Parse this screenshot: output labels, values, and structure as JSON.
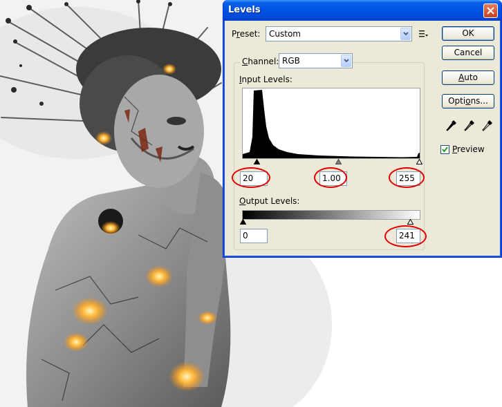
{
  "dialog": {
    "title": "Levels",
    "preset": {
      "label": "Preset:",
      "value": "Custom"
    },
    "channel": {
      "label": "Channel:",
      "value": "RGB"
    },
    "input_levels": {
      "label": "Input Levels:",
      "black": "20",
      "gamma": "1.00",
      "white": "255"
    },
    "output_levels": {
      "label": "Output Levels:",
      "black": "0",
      "white": "241"
    },
    "buttons": {
      "ok": "OK",
      "cancel": "Cancel",
      "auto": "Auto",
      "options": "Options..."
    },
    "preview": {
      "label": "Preview",
      "checked": true
    }
  },
  "colors": {
    "accent": "#0054e3",
    "annotation": "#e00000",
    "dialog_face": "#ece9d8"
  },
  "icons": {
    "close": "close-icon",
    "preset_menu": "preset-options-icon",
    "dropdown": "chevron-down-icon",
    "eyedropper_black": "black-eyedropper-icon",
    "eyedropper_gray": "gray-eyedropper-icon",
    "eyedropper_white": "white-eyedropper-icon"
  }
}
